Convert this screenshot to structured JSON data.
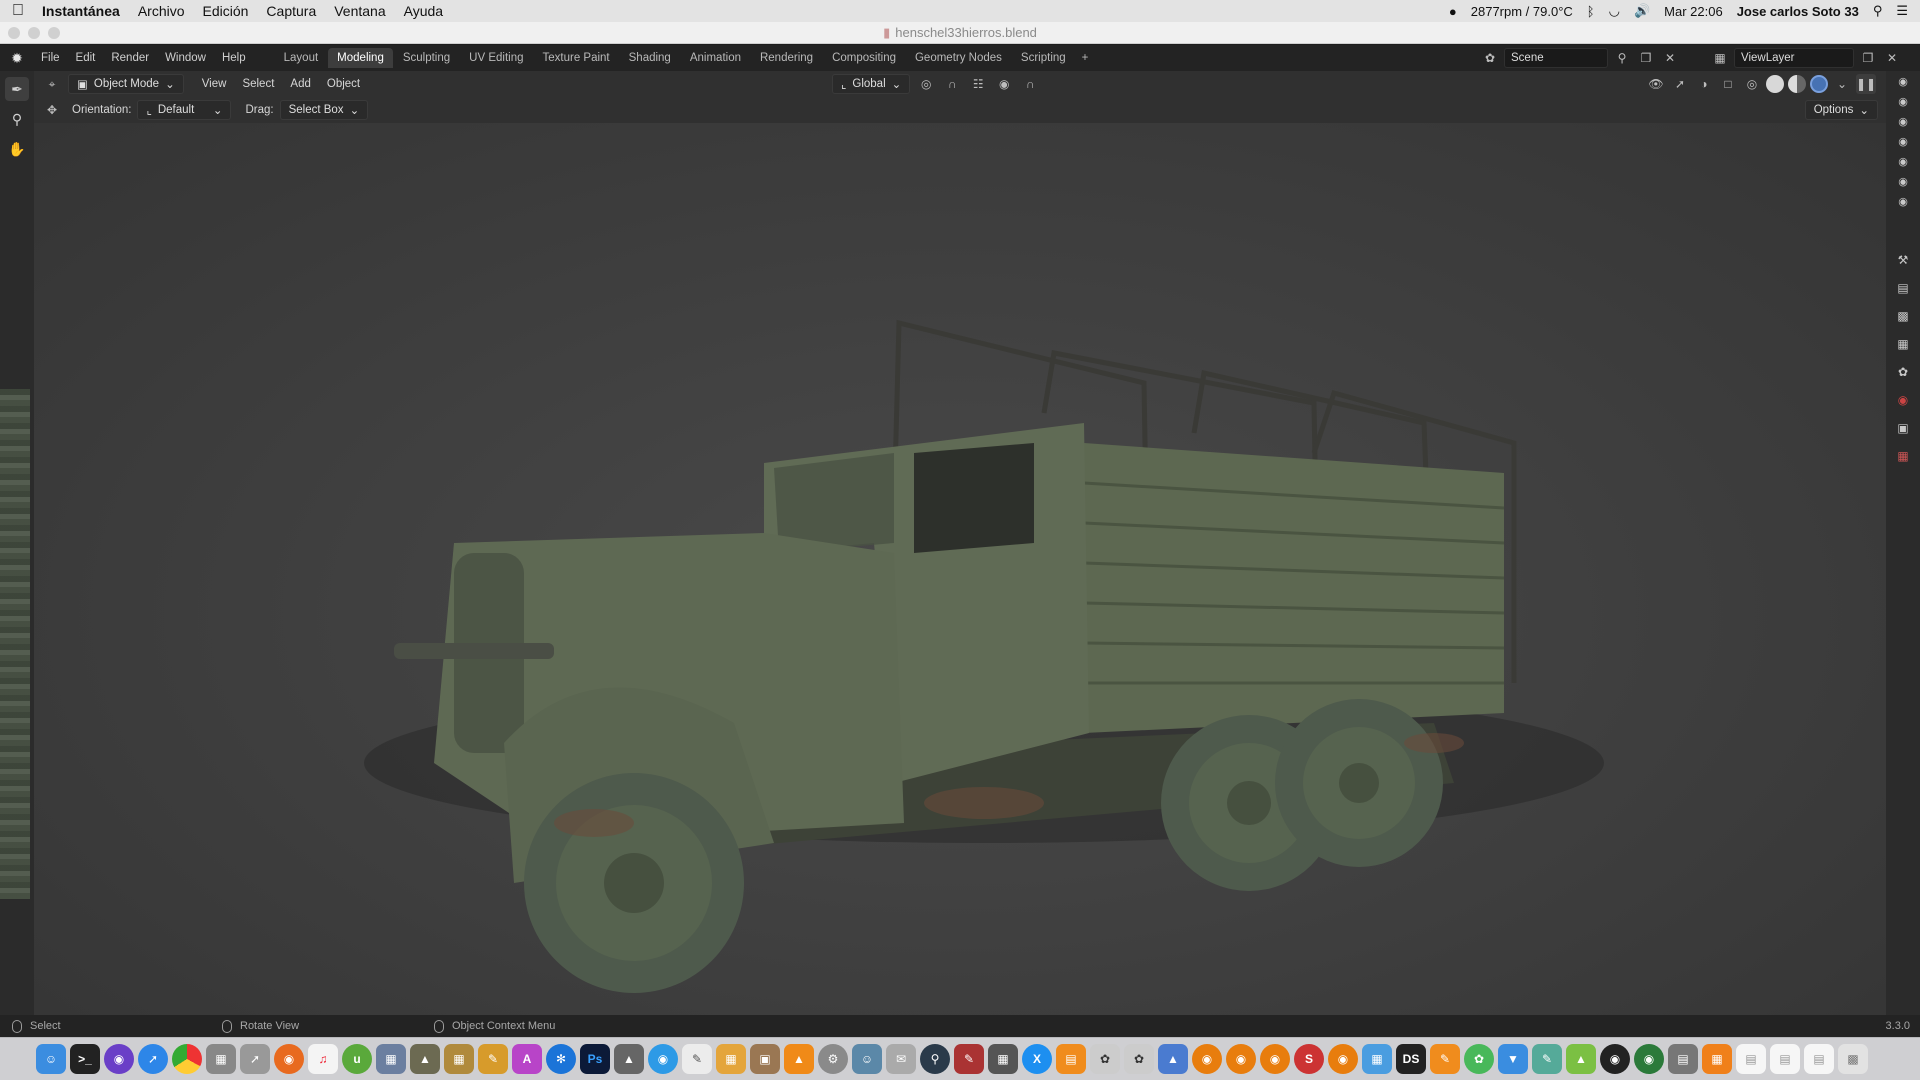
{
  "mac_menubar": {
    "app_name": "Instantánea",
    "menus": [
      "Archivo",
      "Edición",
      "Captura",
      "Ventana",
      "Ayuda"
    ],
    "fan_status": "2877rpm / 79.0°C",
    "clock": "Mar 22:06",
    "user": "Jose carlos Soto 33"
  },
  "window": {
    "title": "henschel33hierros.blend"
  },
  "blender_menu": [
    "File",
    "Edit",
    "Render",
    "Window",
    "Help"
  ],
  "workspace_tabs": [
    {
      "label": "Layout",
      "active": false
    },
    {
      "label": "Modeling",
      "active": true
    },
    {
      "label": "Sculpting",
      "active": false
    },
    {
      "label": "UV Editing",
      "active": false
    },
    {
      "label": "Texture Paint",
      "active": false
    },
    {
      "label": "Shading",
      "active": false
    },
    {
      "label": "Animation",
      "active": false
    },
    {
      "label": "Rendering",
      "active": false
    },
    {
      "label": "Compositing",
      "active": false
    },
    {
      "label": "Geometry Nodes",
      "active": false
    },
    {
      "label": "Scripting",
      "active": false
    }
  ],
  "add_workspace": "+",
  "scene": {
    "name": "Scene"
  },
  "view_layer": {
    "name": "ViewLayer"
  },
  "header": {
    "mode": "Object Mode",
    "menus": [
      "View",
      "Select",
      "Add",
      "Object"
    ],
    "transform_orientation": "Global"
  },
  "tool_settings": {
    "orientation_label": "Orientation:",
    "orientation_value": "Default",
    "drag_label": "Drag:",
    "drag_value": "Select Box",
    "options_label": "Options"
  },
  "status_bar": {
    "select": "Select",
    "rotate": "Rotate View",
    "context": "Object Context Menu",
    "version": "3.3.0"
  },
  "colors": {
    "accent_active_shading": "#4772b3",
    "viewport_bg": "#3e3e3e",
    "truck_green": "#5b6650"
  },
  "icons": {
    "apple": "apple-icon",
    "bluetooth": "bluetooth-icon",
    "wifi": "wifi-icon",
    "volume": "volume-icon",
    "search": "search-icon",
    "blender": "blender-logo-icon"
  }
}
